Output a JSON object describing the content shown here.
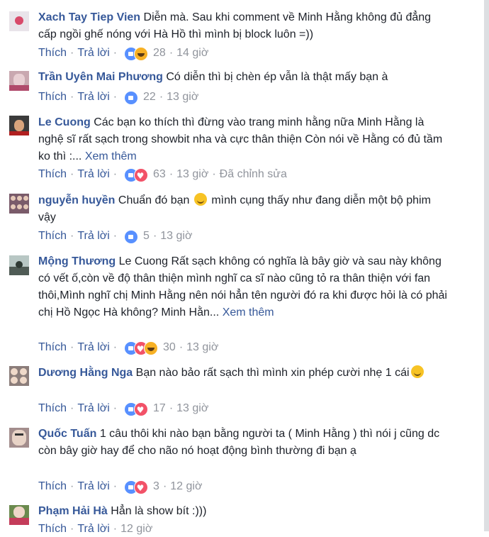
{
  "labels": {
    "like": "Thích",
    "reply": "Trả lời",
    "see_more": "Xem thêm",
    "edited": "Đã chỉnh sửa"
  },
  "comments": [
    {
      "author": "Xach Tay Tiep Vien",
      "text": "Diễn mà. Sau khi comment về Minh Hằng không đủ đẳng cấp ngồi ghế nóng với Hà Hồ thì mình bị block luôn =))",
      "reaction_count": "28",
      "time": "14 giờ",
      "reactions": [
        "like",
        "haha"
      ]
    },
    {
      "author": "Trần Uyên Mai Phương",
      "text": "Có diễn thì bị chèn ép vẫn là thật mấy bạn à",
      "reaction_count": "22",
      "time": "13 giờ",
      "reactions": [
        "like"
      ]
    },
    {
      "author": "Le Cuong",
      "text": "Các bạn ko thích thì đừng vào trang minh hằng nữa Minh Hằng là nghệ sĩ rất sạch trong showbit nha và cực thân thiện Còn nói về Hằng có đủ tầm ko thì :...",
      "reaction_count": "63",
      "time": "13 giờ",
      "reactions": [
        "like",
        "love"
      ]
    },
    {
      "author": "nguyễn huyền",
      "text_before_emoji": "Chuẩn đó bạn",
      "text_after_emoji": "mình cụng thấy như đang diễn một bộ phim vậy",
      "reaction_count": "5",
      "time": "13 giờ",
      "reactions": [
        "like"
      ]
    },
    {
      "author": "Mộng Thương",
      "text": "Le Cuong Rất sạch không có nghĩa là bây giờ và sau này không có vết ố,còn về độ thân thiện mình nghĩ ca sĩ nào cũng tỏ ra thân thiện với fan thôi,Mình nghĩ chị Minh Hằng nên nói hẳn tên người đó ra khi được hỏi là có phải chị Hồ Ngọc Hà không? Minh Hằn...",
      "reaction_count": "30",
      "time": "13 giờ",
      "reactions": [
        "like",
        "love",
        "haha"
      ]
    },
    {
      "author": "Dương Hằng Nga",
      "text_before_emoji": "Bạn nào bảo rất sạch thì mình xin phép cười nhẹ 1 cái",
      "text_after_emoji": "",
      "reaction_count": "17",
      "time": "13 giờ",
      "reactions": [
        "like",
        "love"
      ]
    },
    {
      "author": "Quốc Tuấn",
      "text": "1 câu thôi khi nào bạn bằng người ta ( Minh Hằng ) thì nói j cũng dc còn bây giờ hay để cho não nó hoạt động bình thường đi bạn ạ",
      "reaction_count": "3",
      "time": "12 giờ",
      "reactions": [
        "like",
        "love"
      ]
    },
    {
      "author": "Phạm Hải Hà",
      "text": "Hẳn là show bít :)))",
      "reaction_count": "",
      "time": "12 giờ",
      "reactions": []
    }
  ],
  "colors": {
    "link": "#365899",
    "meta": "#90949c",
    "like": "#5890ff",
    "love": "#f25268",
    "haha": "#f7b125"
  }
}
